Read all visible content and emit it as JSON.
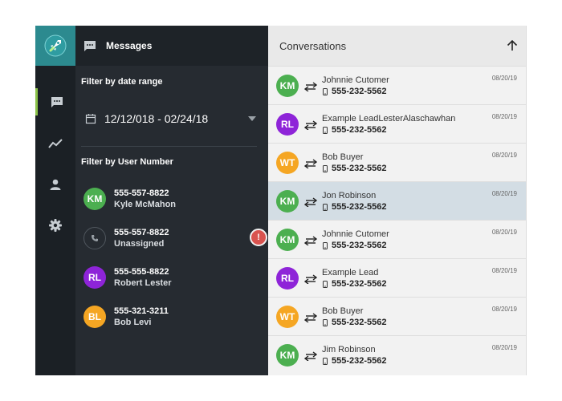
{
  "colors": {
    "rail_bg": "#1b2025",
    "panel_bg": "#262b31",
    "logo_bg": "#2c8a8f",
    "active_accent": "#8bc34a",
    "alert": "#d9534f",
    "selected_row": "#d3dde4"
  },
  "nav": {
    "items": [
      {
        "icon": "chat-icon",
        "active": true
      },
      {
        "icon": "trend-chart-icon",
        "active": false
      },
      {
        "icon": "user-icon",
        "active": false
      },
      {
        "icon": "gear-icon",
        "active": false
      }
    ]
  },
  "panel": {
    "header_title": "Messages",
    "date_filter_label": "Filter by date range",
    "date_range": "12/12/018 - 02/24/18",
    "user_filter_label": "Filter by User Number",
    "users": [
      {
        "initials": "KM",
        "color": "#4caf50",
        "number": "555-557-8822",
        "name": "Kyle McMahon"
      },
      {
        "initials": "",
        "color": "",
        "icon": "phone-icon",
        "number": "555-557-8822",
        "name": "Unassigned",
        "alert": "!"
      },
      {
        "initials": "RL",
        "color": "#8e24d8",
        "number": "555-555-8822",
        "name": "Robert Lester"
      },
      {
        "initials": "BL",
        "color": "#f5a623",
        "number": "555-321-3211",
        "name": "Bob Levi"
      }
    ]
  },
  "conversations": {
    "title": "Conversations",
    "items": [
      {
        "initials": "KM",
        "color": "#4caf50",
        "name": "Johnnie Cutomer",
        "phone": "555-232-5562",
        "date": "08/20/19",
        "selected": false
      },
      {
        "initials": "RL",
        "color": "#8e24d8",
        "name": "Example LeadLesterAlaschawhan",
        "phone": "555-232-5562",
        "date": "08/20/19",
        "selected": false
      },
      {
        "initials": "WT",
        "color": "#f5a623",
        "name": "Bob Buyer",
        "phone": "555-232-5562",
        "date": "08/20/19",
        "selected": false
      },
      {
        "initials": "KM",
        "color": "#4caf50",
        "name": "Jon Robinson",
        "phone": "555-232-5562",
        "date": "08/20/19",
        "selected": true
      },
      {
        "initials": "KM",
        "color": "#4caf50",
        "name": "Johnnie Cutomer",
        "phone": "555-232-5562",
        "date": "08/20/19",
        "selected": false
      },
      {
        "initials": "RL",
        "color": "#8e24d8",
        "name": "Example Lead",
        "phone": "555-232-5562",
        "date": "08/20/19",
        "selected": false
      },
      {
        "initials": "WT",
        "color": "#f5a623",
        "name": "Bob Buyer",
        "phone": "555-232-5562",
        "date": "08/20/19",
        "selected": false
      },
      {
        "initials": "KM",
        "color": "#4caf50",
        "name": "Jim Robinson",
        "phone": "555-232-5562",
        "date": "08/20/19",
        "selected": false
      }
    ]
  }
}
